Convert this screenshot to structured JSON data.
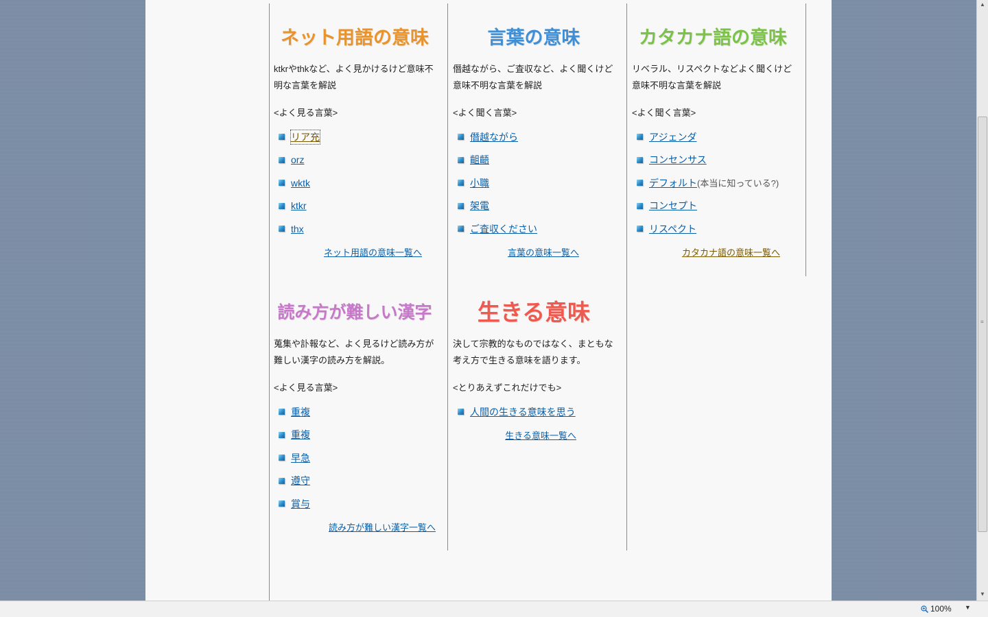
{
  "columns": [
    {
      "title": "ネット用語の意味",
      "title_color": "#e8932c",
      "desc": "ktkrやthkなど、よく見かけるけど意味不明な言葉を解説",
      "subhead": "<よく見る言葉>",
      "items": [
        {
          "label": "リア充",
          "note": ""
        },
        {
          "label": "orz",
          "note": ""
        },
        {
          "label": "wktk",
          "note": ""
        },
        {
          "label": "ktkr",
          "note": ""
        },
        {
          "label": "thx",
          "note": ""
        }
      ],
      "more": "ネット用語の意味一覧へ"
    },
    {
      "title": "言葉の意味",
      "title_color": "#3f8fd6",
      "desc": "僭越ながら、ご査収など、よく聞くけど意味不明な言葉を解説",
      "subhead": "<よく聞く言葉>",
      "items": [
        {
          "label": "僭越ながら",
          "note": ""
        },
        {
          "label": "齟齬",
          "note": ""
        },
        {
          "label": "小職",
          "note": ""
        },
        {
          "label": "架電",
          "note": ""
        },
        {
          "label": "ご査収ください",
          "note": ""
        }
      ],
      "more": "言葉の意味一覧へ"
    },
    {
      "title": "カタカナ語の意味",
      "title_color": "#7cc24a",
      "desc": "リベラル、リスペクトなどよく聞くけど意味不明な言葉を解説",
      "subhead": "<よく聞く言葉>",
      "items": [
        {
          "label": "アジェンダ",
          "note": ""
        },
        {
          "label": "コンセンサス",
          "note": ""
        },
        {
          "label": "デフォルト",
          "note": "(本当に知っている?)"
        },
        {
          "label": "コンセプト",
          "note": ""
        },
        {
          "label": "リスペクト",
          "note": ""
        }
      ],
      "more": "カタカナ語の意味一覧へ"
    },
    {
      "title": "読み方が難しい漢字",
      "title_color": "#c679c9",
      "desc": "蒐集や訃報など、よく見るけど読み方が難しい漢字の読み方を解説。",
      "subhead": "<よく見る言葉>",
      "items": [
        {
          "label": "重複",
          "note": ""
        },
        {
          "label": "重複",
          "note": ""
        },
        {
          "label": "早急",
          "note": ""
        },
        {
          "label": "遵守",
          "note": ""
        },
        {
          "label": "賞与",
          "note": ""
        }
      ],
      "more": "読み方が難しい漢字一覧へ"
    },
    {
      "title": "生きる意味",
      "title_color": "#ef5a50",
      "desc": "決して宗教的なものではなく、まともな考え方で生きる意味を語ります。",
      "subhead": "<とりあえずこれだけでも>",
      "items": [
        {
          "label": "人間の生きる意味を思う",
          "note": ""
        }
      ],
      "more": "生きる意味一覧へ"
    }
  ],
  "statusbar": {
    "zoom": "100%"
  },
  "scrollbar": {
    "up": "▲",
    "down": "▼",
    "grip": "≡"
  }
}
